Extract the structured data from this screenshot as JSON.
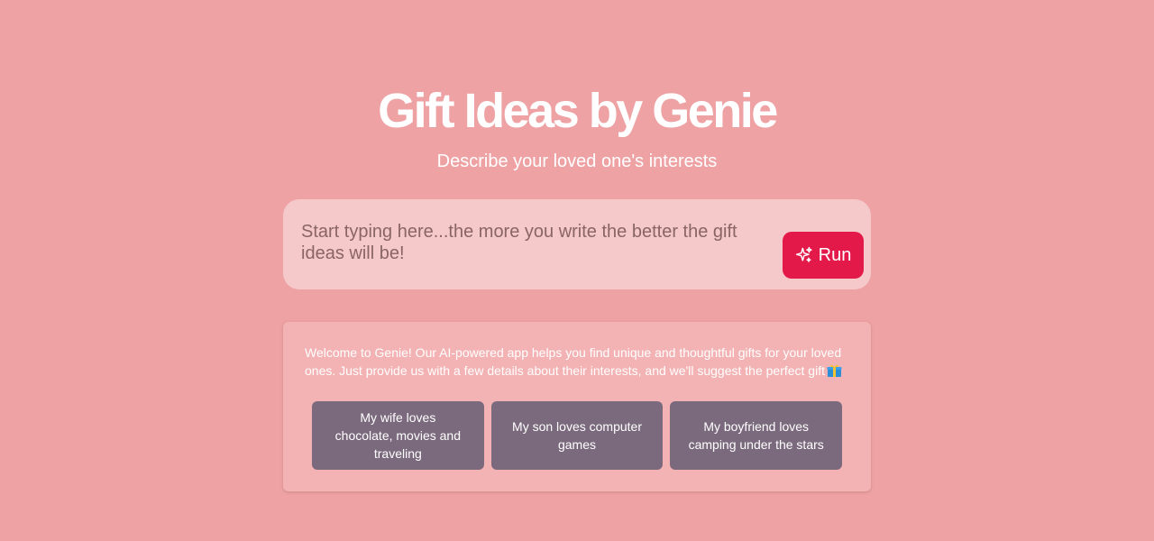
{
  "header": {
    "title": "Gift Ideas by Genie",
    "subtitle": "Describe your loved one's interests"
  },
  "prompt": {
    "placeholder": "Start typing here...the more you write the better the gift ideas will be!",
    "value": ""
  },
  "run_button": {
    "label": "Run",
    "icon": "sparkles-icon"
  },
  "info": {
    "welcome": "Welcome to Genie! Our AI-powered app helps you find unique and thoughtful gifts for your loved ones. Just provide us with a few details about their interests, and we'll suggest the perfect gift",
    "welcome_icon": "gift-icon"
  },
  "examples": [
    {
      "label": "My wife loves chocolate, movies and traveling"
    },
    {
      "label": "My son loves computer games"
    },
    {
      "label": "My boyfriend loves camping under the stars"
    }
  ],
  "colors": {
    "background": "#eea2a4",
    "accent": "#e3194a",
    "example_button": "#7b6a7d"
  }
}
